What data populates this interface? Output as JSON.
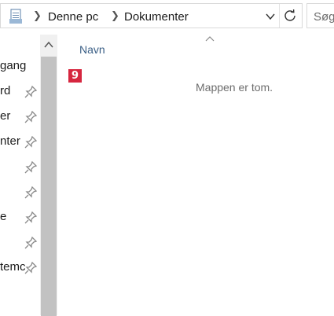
{
  "address_bar": {
    "breadcrumbs": [
      "Denne pc",
      "Dokumenter"
    ],
    "icons": {
      "location": "folder-doc-icon",
      "dropdown": "chevron-down-icon",
      "refresh": "refresh-icon"
    }
  },
  "search": {
    "placeholder": "Søg"
  },
  "nav_pane": {
    "items": [
      {
        "label": "gang",
        "pinned": false
      },
      {
        "label": "rd",
        "pinned": true
      },
      {
        "label": "er",
        "pinned": true
      },
      {
        "label": "nter",
        "pinned": true
      },
      {
        "label": "",
        "pinned": true
      },
      {
        "label": "",
        "pinned": true
      },
      {
        "label": "e",
        "pinned": true
      },
      {
        "label": "",
        "pinned": true
      },
      {
        "label": "temc",
        "pinned": true
      }
    ]
  },
  "content": {
    "column_header": "Navn",
    "badge": "9",
    "empty_message": "Mappen er tom."
  },
  "colors": {
    "badge": "#d6263f",
    "header_text": "#3b5f86",
    "scroll_thumb": "#c2c2c2"
  }
}
